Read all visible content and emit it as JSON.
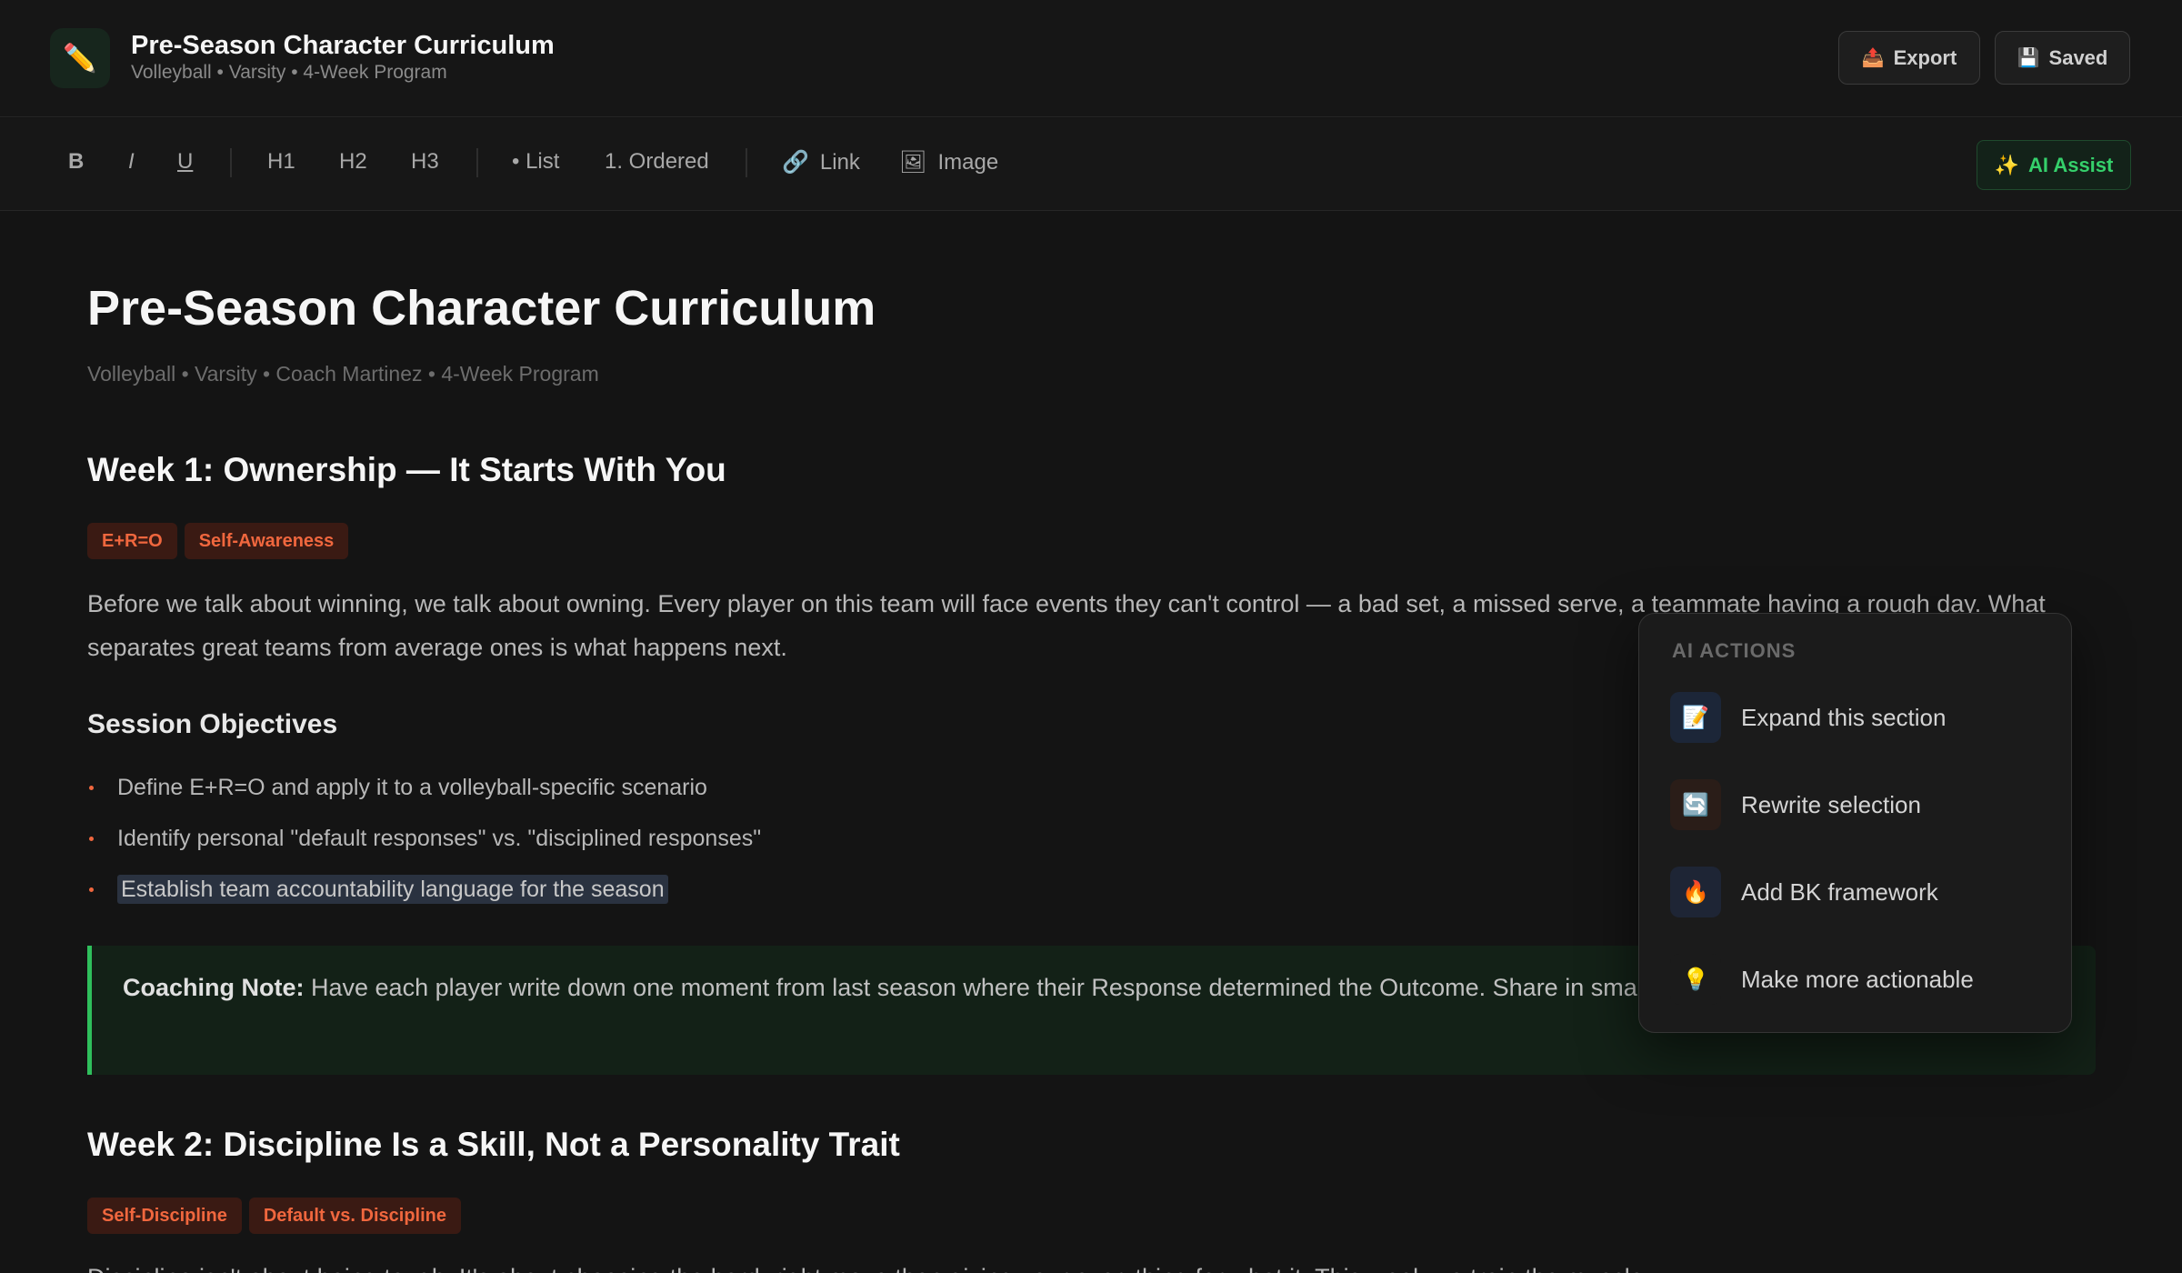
{
  "header": {
    "logo_icon": "✏️",
    "title": "Pre-Season Character Curriculum",
    "subtitle": "Volleyball • Varsity • 4-Week Program",
    "export_icon": "📤",
    "export_label": "Export",
    "saved_icon": "💾",
    "saved_label": "Saved"
  },
  "toolbar": {
    "bold": "B",
    "italic": "I",
    "underline": "U",
    "h1": "H1",
    "h2": "H2",
    "h3": "H3",
    "list": "• List",
    "ordered": "1. Ordered",
    "link_icon": "🔗",
    "link": "Link",
    "image_icon": "🖼",
    "image": "Image",
    "ai_icon": "✨",
    "ai_assist": "AI Assist"
  },
  "doc": {
    "title": "Pre-Season Character Curriculum",
    "meta": "Volleyball • Varsity • Coach Martinez • 4-Week Program",
    "week1": {
      "heading": "Week 1: Ownership — It Starts With You",
      "tags": [
        "E+R=O",
        "Self-Awareness"
      ],
      "paragraph": "Before we talk about winning, we talk about owning. Every player on this team will face events they can't control — a bad set, a missed serve, a teammate having a rough day. What separates great teams from average ones is what happens next.",
      "objectives_heading": "Session Objectives",
      "objectives": [
        "Define E+R=O and apply it to a volleyball-specific scenario",
        "Identify personal \"default responses\" vs. \"disciplined responses\"",
        "Establish team accountability language for the season"
      ],
      "note_label": "Coaching Note:",
      "note_text": " Have each player write down one moment from last season where their Response determined the Outcome. Share in small groups before the season starts."
    },
    "week2": {
      "heading": "Week 2: Discipline Is a Skill, Not a Personality Trait",
      "tags": [
        "Self-Discipline",
        "Default vs. Discipline"
      ],
      "paragraph": "Discipline isn't about being tough. It's about choosing the hard, right move then giving your everything for what it. This week we train the muscle."
    }
  },
  "ai_panel": {
    "title": "AI ACTIONS",
    "items": [
      {
        "icon": "📝",
        "label": "Expand this section"
      },
      {
        "icon": "🔄",
        "label": "Rewrite selection"
      },
      {
        "icon": "🔥",
        "label": "Add BK framework"
      },
      {
        "icon": "💡",
        "label": "Make more actionable"
      }
    ]
  }
}
